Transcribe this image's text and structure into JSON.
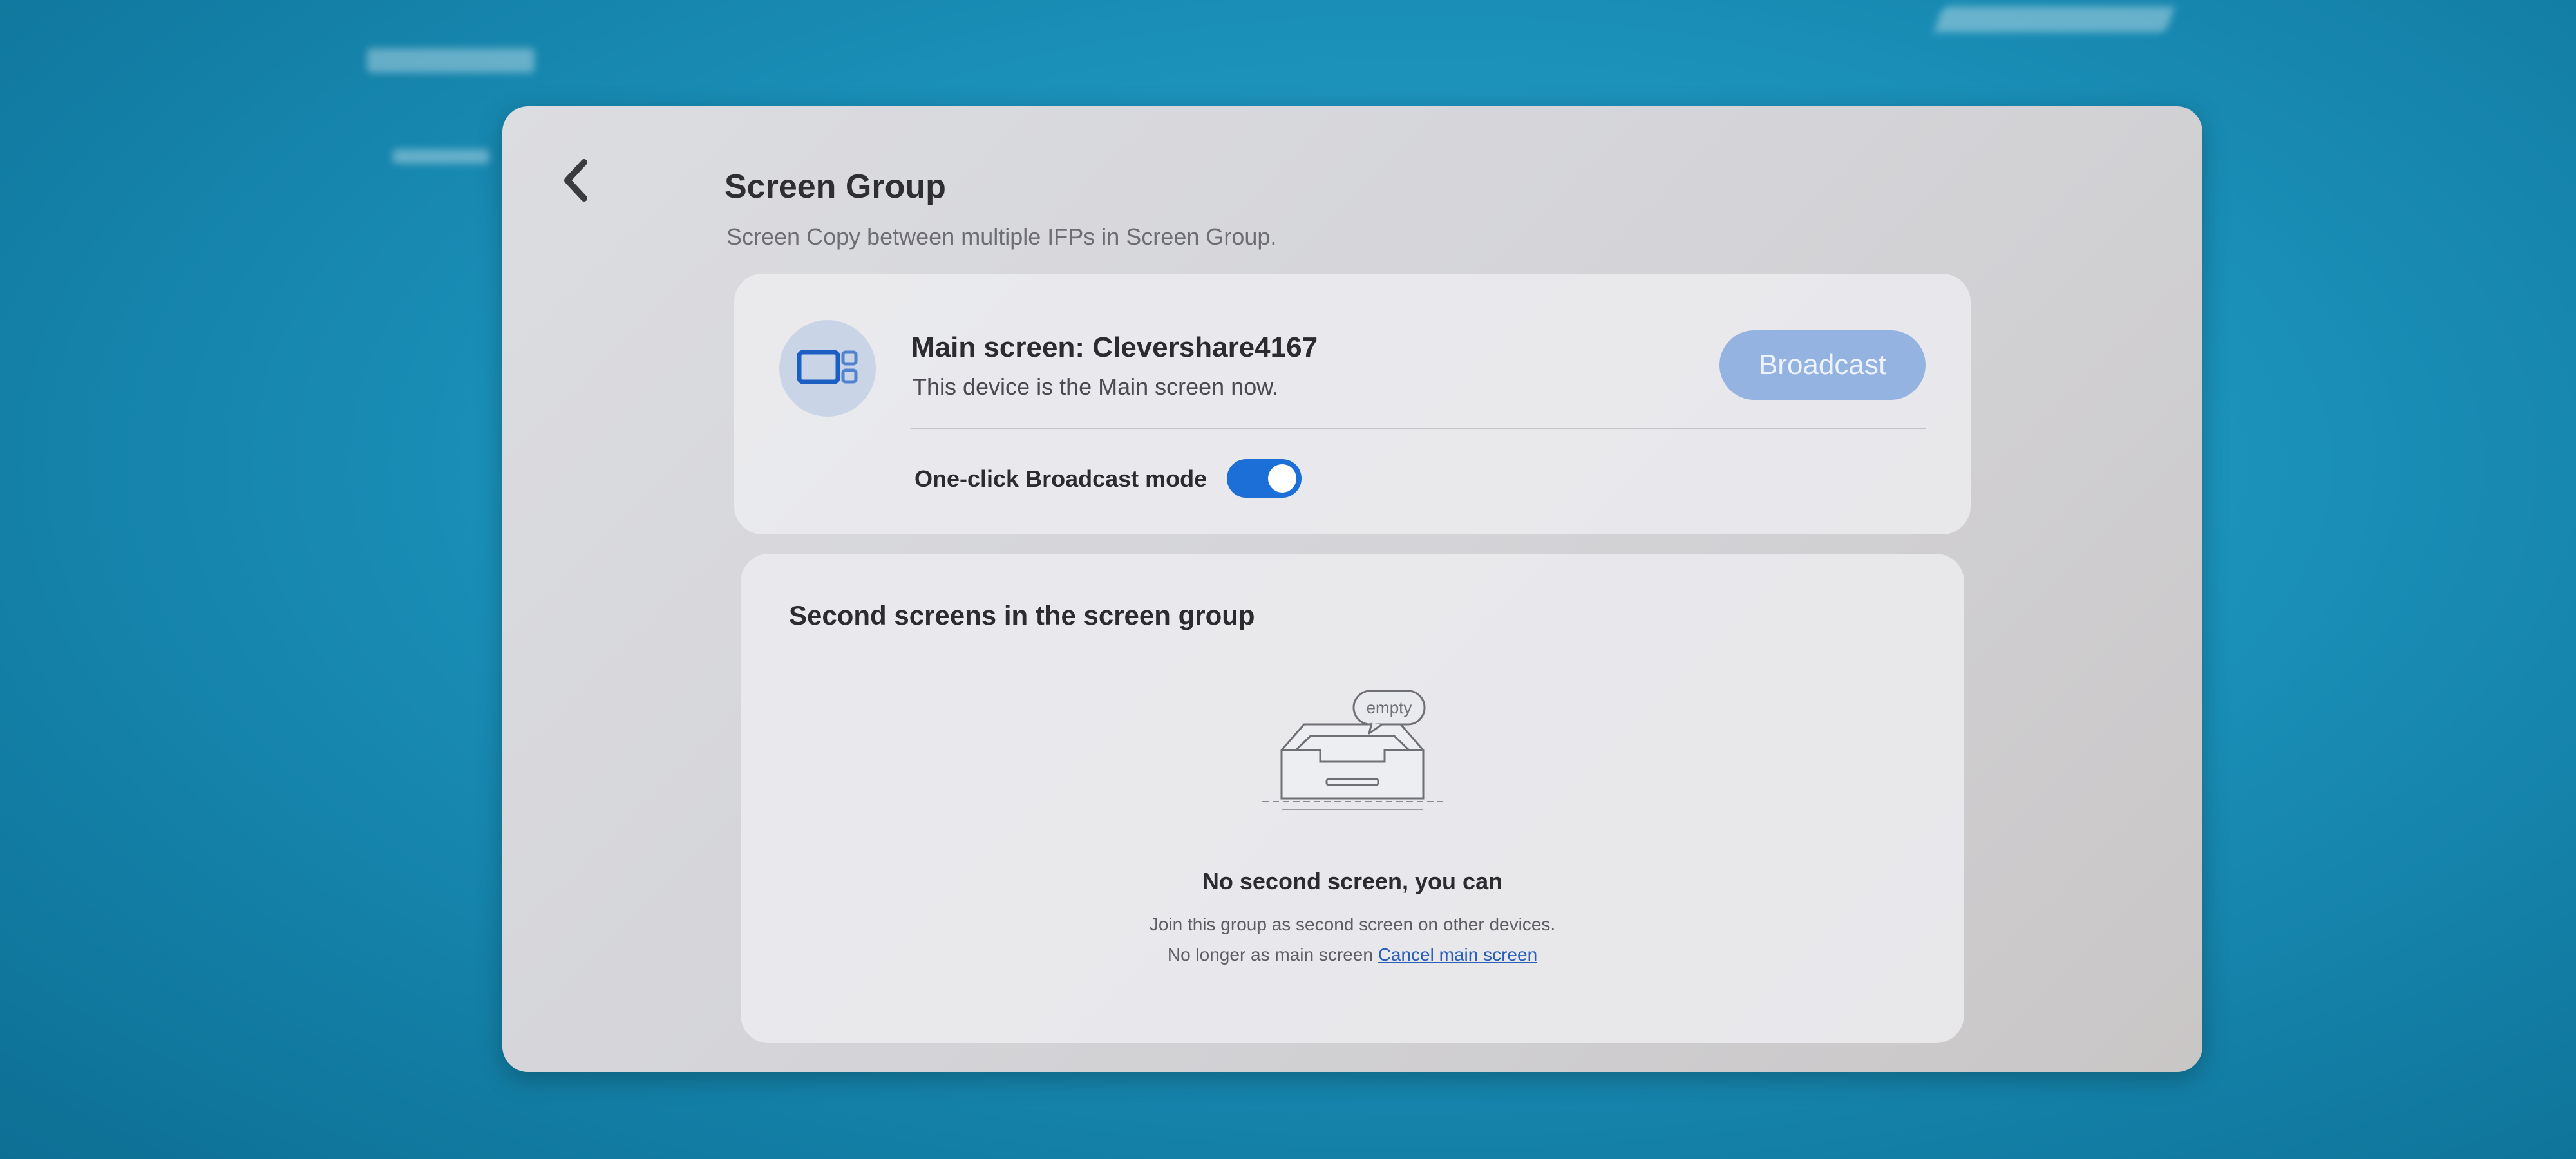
{
  "header": {
    "title": "Screen Group",
    "subtitle": "Screen Copy between multiple IFPs in Screen Group."
  },
  "main_card": {
    "name": "Main screen: Clevershare4167",
    "description": "This device is the Main screen now.",
    "broadcast_label": "Broadcast",
    "mode_label": "One-click Broadcast mode",
    "mode_enabled": true
  },
  "second_card": {
    "title": "Second screens in the screen group",
    "empty_badge": "empty",
    "empty_title": "No second screen, you can",
    "line1": "Join this group as second screen on other devices.",
    "line2_prefix": "No longer as main screen",
    "cancel_link": "Cancel main screen"
  },
  "colors": {
    "accent": "#1c6fd6",
    "button_disabled": "#94b3e0",
    "link": "#2a5fb8"
  },
  "icons": {
    "back": "chevron-left-icon",
    "device": "screen-group-icon",
    "empty": "empty-inbox-icon"
  }
}
